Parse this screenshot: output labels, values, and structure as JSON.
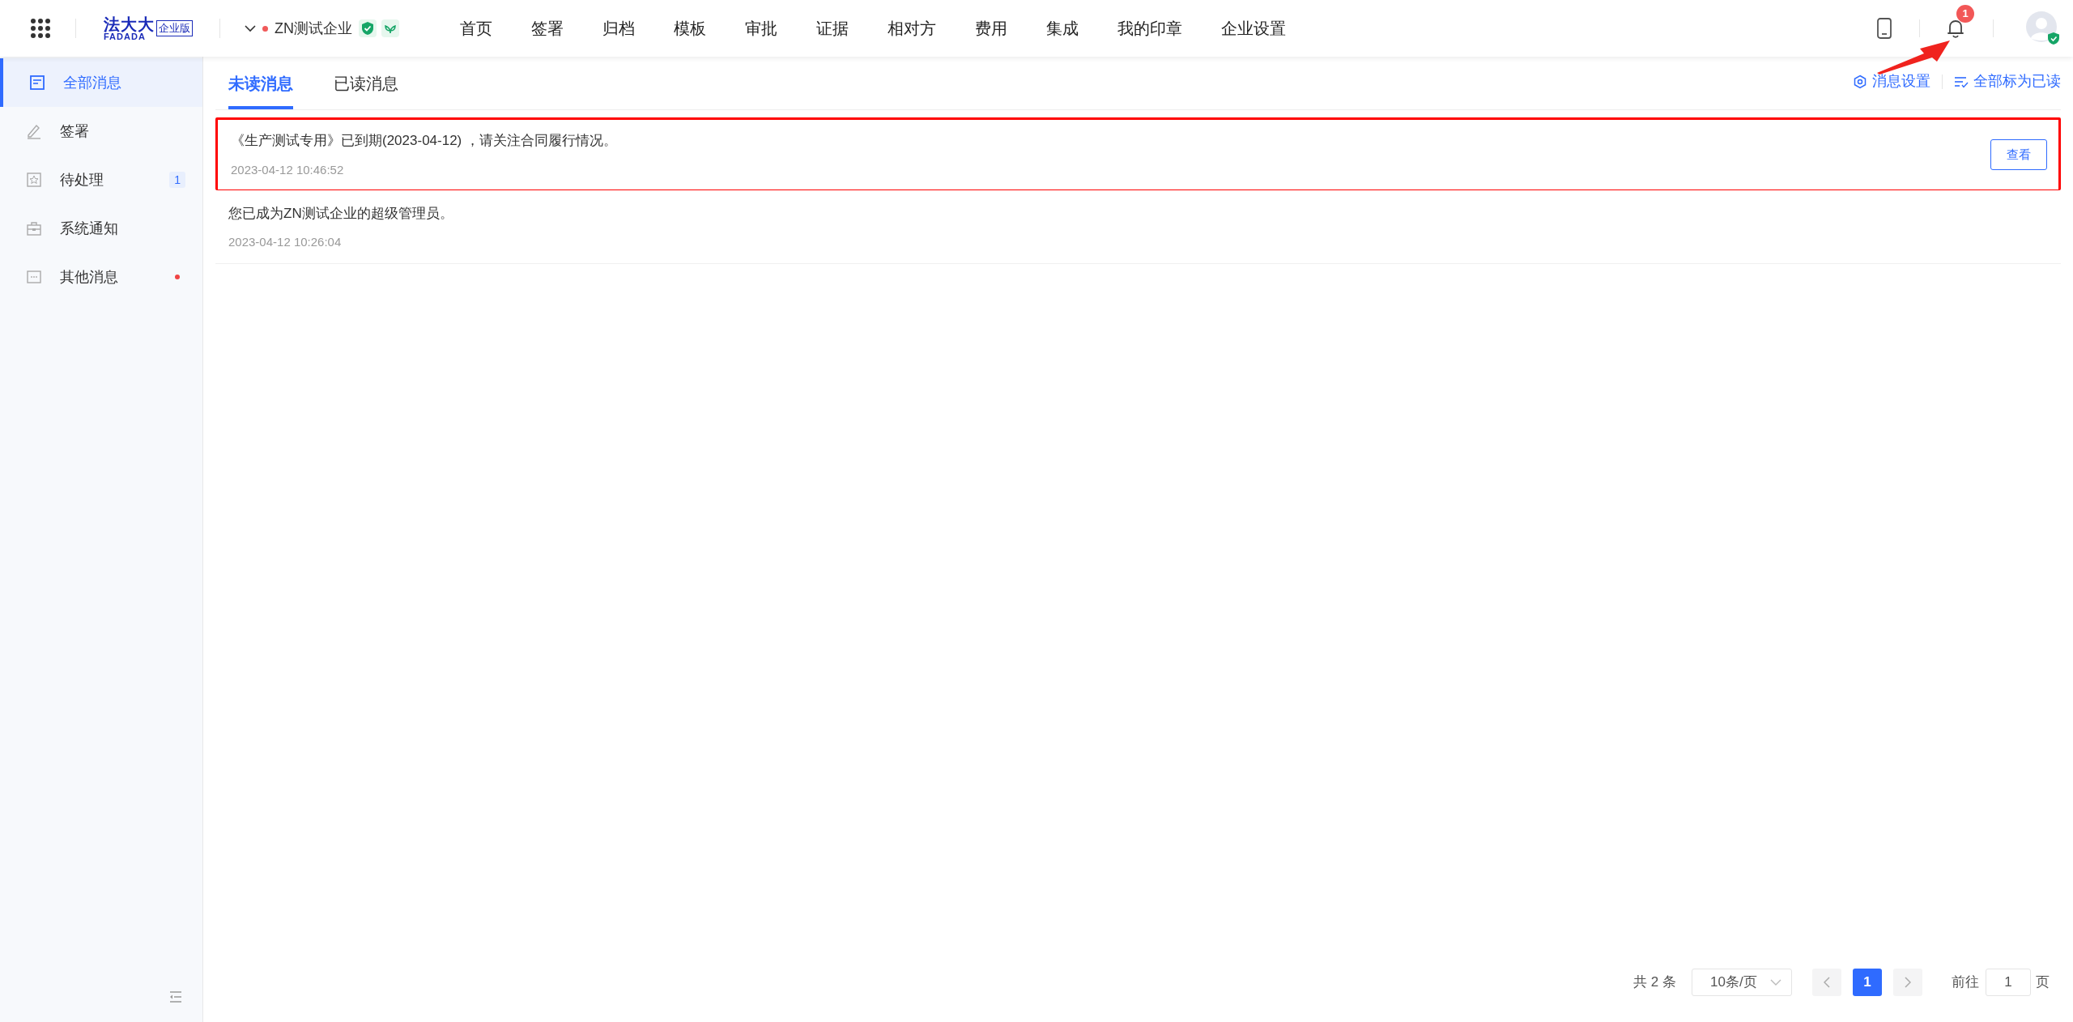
{
  "header": {
    "logo_text": "法大大",
    "logo_sub": "FADADA",
    "edition": "企业版",
    "company": "ZN测试企业",
    "company_dot": true,
    "nav": [
      {
        "label": "首页"
      },
      {
        "label": "签署"
      },
      {
        "label": "归档"
      },
      {
        "label": "模板"
      },
      {
        "label": "审批"
      },
      {
        "label": "证据"
      },
      {
        "label": "相对方"
      },
      {
        "label": "费用"
      },
      {
        "label": "集成"
      },
      {
        "label": "我的印章"
      },
      {
        "label": "企业设置"
      }
    ],
    "notification_count": "1"
  },
  "sidebar": {
    "items": [
      {
        "label": "全部消息",
        "kind": "list",
        "selected": true
      },
      {
        "label": "签署",
        "kind": "pen",
        "selected": false
      },
      {
        "label": "待处理",
        "kind": "star",
        "selected": false,
        "count": "1"
      },
      {
        "label": "系统通知",
        "kind": "case",
        "selected": false
      },
      {
        "label": "其他消息",
        "kind": "dots",
        "selected": false,
        "dot": true
      }
    ]
  },
  "tabs": [
    {
      "label": "未读消息",
      "selected": true
    },
    {
      "label": "已读消息",
      "selected": false
    }
  ],
  "actions": [
    "消息设置",
    "全部标为已读"
  ],
  "messages": [
    {
      "text": "《生产测试专用》已到期(2023-04-12) ，请关注合同履行情况。",
      "time": "2023-04-12 10:46:52",
      "button": "查看",
      "highlighted": true
    },
    {
      "text": "您已成为ZN测试企业的超级管理员。",
      "time": "2023-04-12 10:26:04",
      "highlighted": false
    }
  ],
  "pagination": {
    "total": "共 2 条",
    "page_size": "10条/页",
    "pages": [
      {
        "label": "1",
        "selected": true
      }
    ],
    "goto_label": "前往",
    "goto_value": "1",
    "goto_suffix": "页"
  }
}
